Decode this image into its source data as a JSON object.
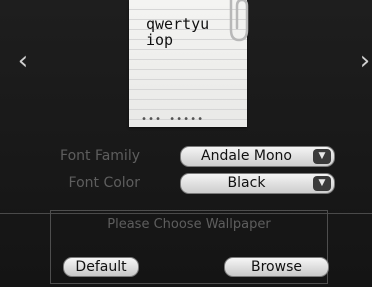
{
  "navigation": {
    "prev_glyph": "‹",
    "next_glyph": "›"
  },
  "note": {
    "text": "qwertyu\niop",
    "rings": "••• •••••"
  },
  "settings": {
    "font_family_label": "Font Family",
    "font_family_value": "Andale Mono",
    "font_color_label": "Font Color",
    "font_color_value": "Black",
    "dropdown_caret": "▼"
  },
  "wallpaper": {
    "title": "Please Choose Wallpaper",
    "default_label": "Default",
    "browse_label": "Browse"
  },
  "colors": {
    "background": "#1a1a1a",
    "label_gray": "#5e5e5e",
    "note_paper": "#f2f2f0"
  },
  "icons": {
    "prev": "chevron-left-icon",
    "next": "chevron-right-icon",
    "clip": "paperclip-icon",
    "caret": "dropdown-caret-icon"
  }
}
